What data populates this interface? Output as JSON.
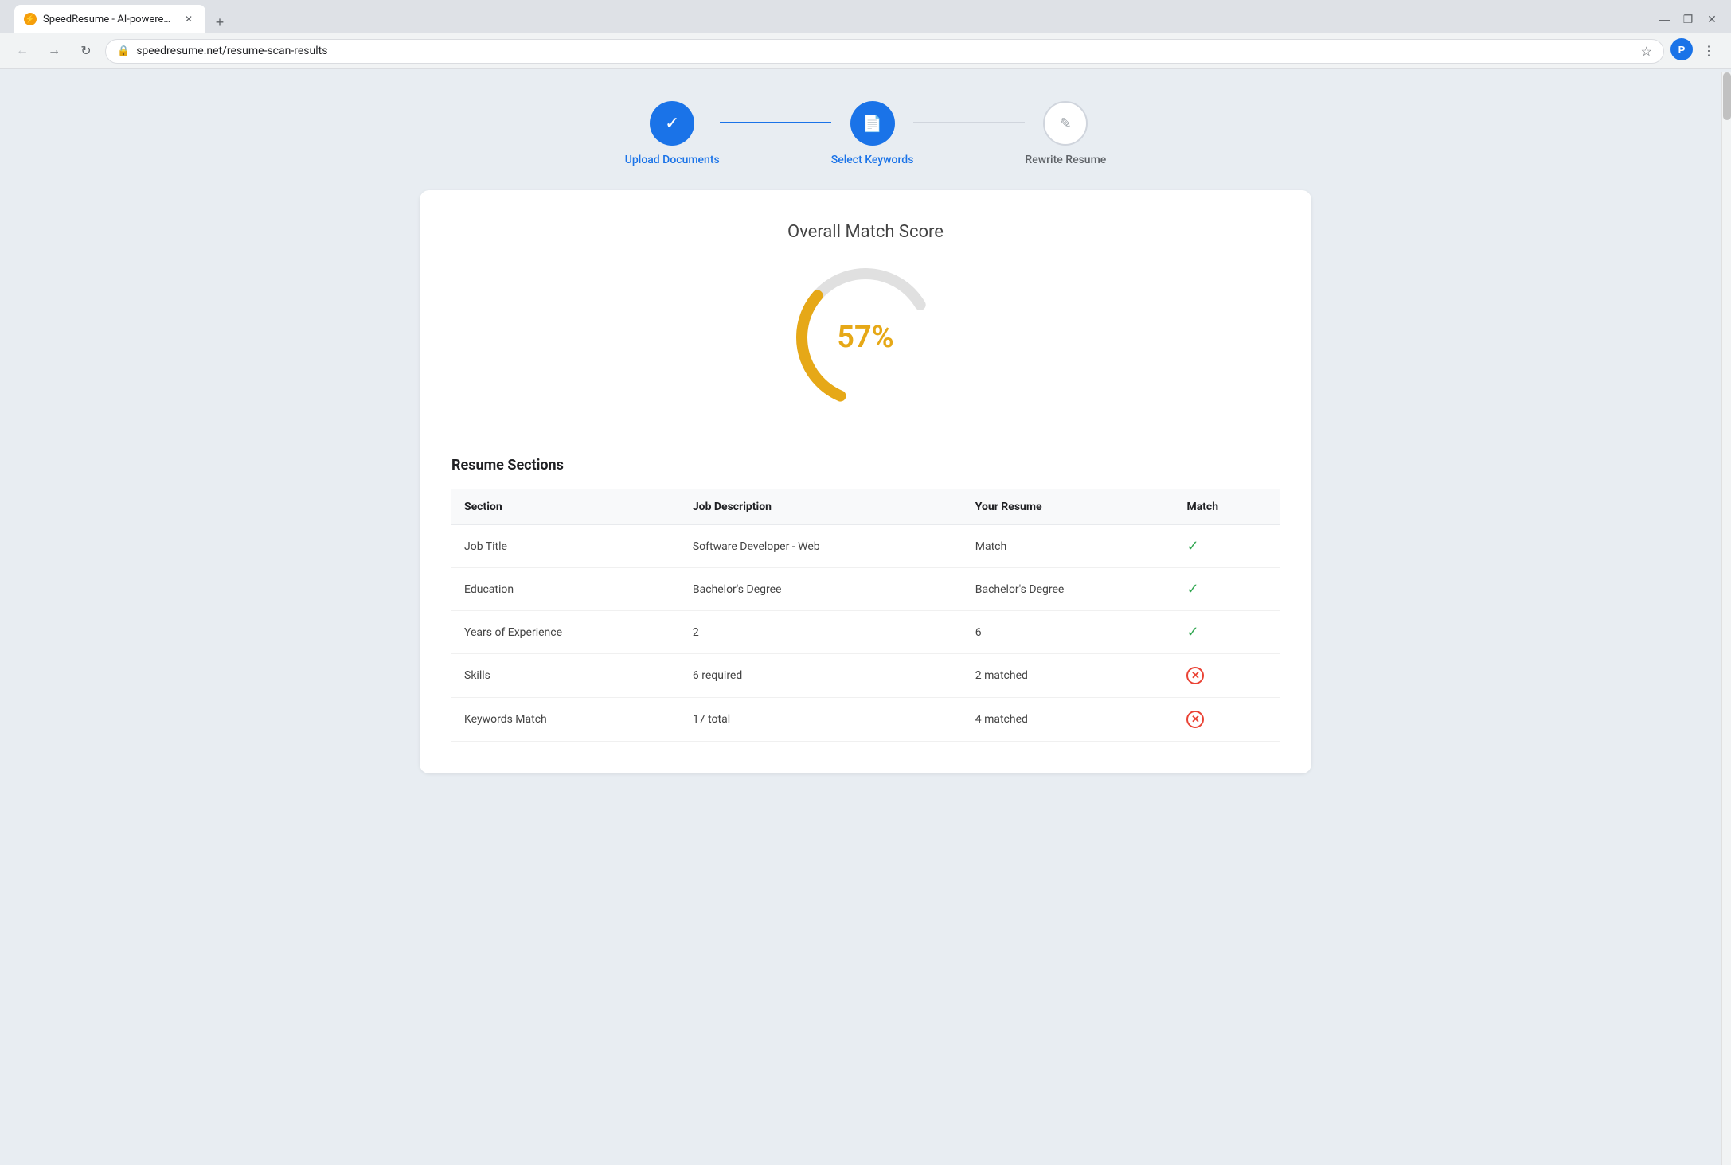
{
  "browser": {
    "tab_title": "SpeedResume - AI-powered re...",
    "tab_favicon": "⚡",
    "url": "speedresume.net/resume-scan-results",
    "new_tab_label": "+",
    "win_minimize": "—",
    "win_maximize": "❐",
    "win_close": "✕"
  },
  "steps": [
    {
      "id": "upload",
      "label": "Upload Documents",
      "state": "active",
      "icon": "✓"
    },
    {
      "id": "keywords",
      "label": "Select Keywords",
      "state": "active",
      "icon": "📄"
    },
    {
      "id": "rewrite",
      "label": "Rewrite Resume",
      "state": "inactive",
      "icon": "✎"
    }
  ],
  "score": {
    "title": "Overall Match Score",
    "value": "57%",
    "percentage": 57
  },
  "resume_sections": {
    "title": "Resume Sections",
    "headers": [
      "Section",
      "Job Description",
      "Your Resume",
      "Match"
    ],
    "rows": [
      {
        "section": "Job Title",
        "job_desc": "Software Developer - Web",
        "your_resume": "Match",
        "match": "check"
      },
      {
        "section": "Education",
        "job_desc": "Bachelor's Degree",
        "your_resume": "Bachelor's Degree",
        "match": "check"
      },
      {
        "section": "Years of Experience",
        "job_desc": "2",
        "your_resume": "6",
        "match": "check"
      },
      {
        "section": "Skills",
        "job_desc": "6 required",
        "your_resume": "2 matched",
        "match": "x"
      },
      {
        "section": "Keywords Match",
        "job_desc": "17 total",
        "your_resume": "4 matched",
        "match": "x"
      }
    ]
  }
}
